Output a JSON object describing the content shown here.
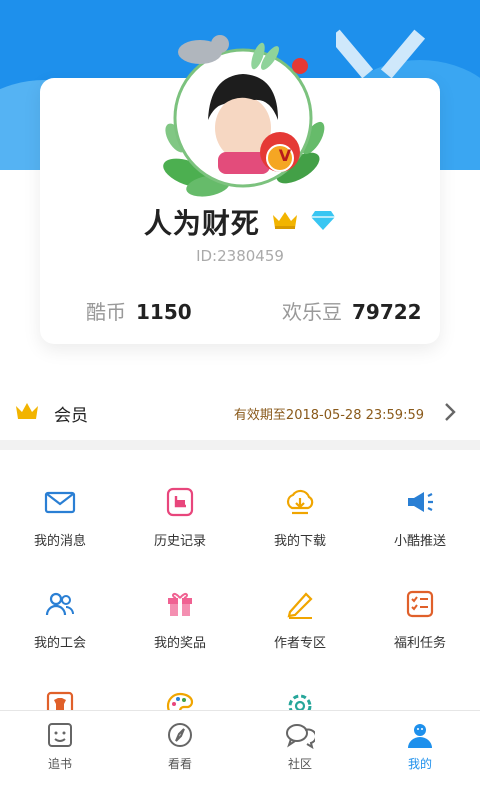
{
  "profile": {
    "nickname": "人为财死",
    "user_id": "ID:2380459",
    "avatar_badge": "V",
    "coins_label": "酷币",
    "coins_value": "1150",
    "beans_label": "欢乐豆",
    "beans_value": "79722"
  },
  "membership": {
    "label": "会员",
    "expiry": "有效期至2018-05-28 23:59:59"
  },
  "grid": [
    {
      "label": "我的消息",
      "icon": "envelope-icon"
    },
    {
      "label": "历史记录",
      "icon": "history-icon"
    },
    {
      "label": "我的下载",
      "icon": "download-icon"
    },
    {
      "label": "小酷推送",
      "icon": "megaphone-icon"
    },
    {
      "label": "我的工会",
      "icon": "guild-icon"
    },
    {
      "label": "我的奖品",
      "icon": "gift-icon"
    },
    {
      "label": "作者专区",
      "icon": "pencil-icon"
    },
    {
      "label": "福利任务",
      "icon": "tasks-icon"
    }
  ],
  "nav": [
    {
      "label": "追书",
      "icon": "bookshelf-icon"
    },
    {
      "label": "看看",
      "icon": "compass-icon"
    },
    {
      "label": "社区",
      "icon": "chat-icon"
    },
    {
      "label": "我的",
      "icon": "user-icon",
      "active": true
    }
  ],
  "colors": {
    "accent": "#1e90ec",
    "expiry": "#8a5a1b",
    "crown": "#f2b400"
  }
}
